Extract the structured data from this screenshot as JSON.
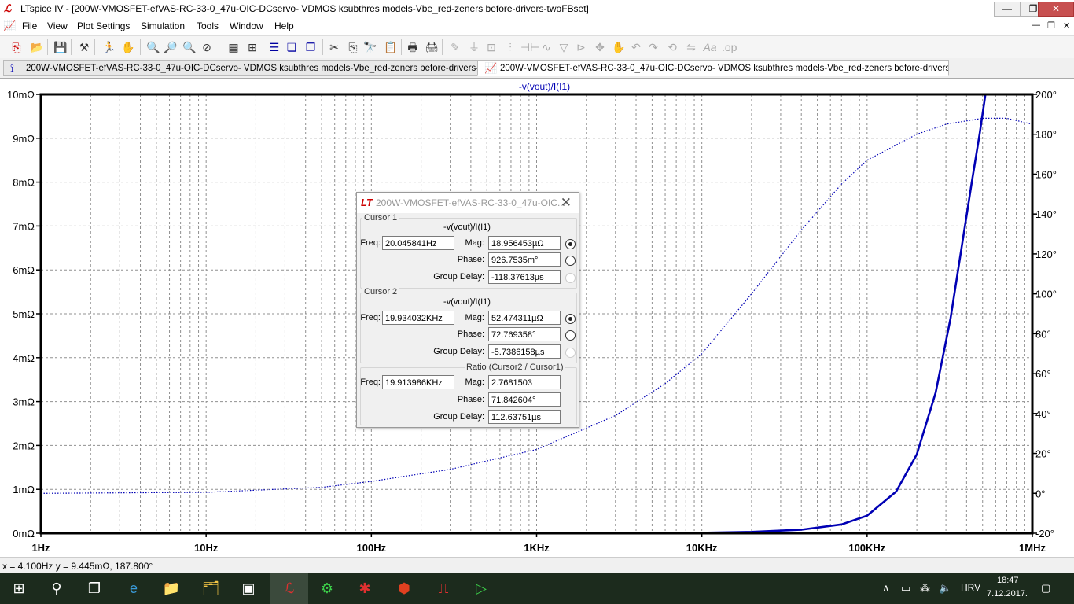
{
  "window": {
    "title": "LTspice IV - [200W-VMOSFET-efVAS-RC-33-0_47u-OIC-DCservo- VDMOS ksubthres models-Vbe_red-zeners before-drivers-twoFBset]",
    "min": "—",
    "max": "❐",
    "close": "✕"
  },
  "menu": [
    "File",
    "View",
    "Plot Settings",
    "Simulation",
    "Tools",
    "Window",
    "Help"
  ],
  "tabs": [
    {
      "label": "200W-VMOSFET-efVAS-RC-33-0_47u-OIC-DCservo- VDMOS ksubthres models-Vbe_red-zeners before-drivers-twoFBset",
      "icon": "schematic-icon"
    },
    {
      "label": "200W-VMOSFET-efVAS-RC-33-0_47u-OIC-DCservo- VDMOS ksubthres models-Vbe_red-zeners before-drivers-twoFBset",
      "icon": "waveform-icon"
    }
  ],
  "chart_data": {
    "type": "line",
    "title": "-v(vout)/I(I1)",
    "x_scale": "log",
    "xlim": [
      1,
      1000000
    ],
    "x_ticks": [
      "1Hz",
      "10Hz",
      "100Hz",
      "1KHz",
      "10KHz",
      "100KHz",
      "1MHz"
    ],
    "y_left_ticks": [
      "0mΩ",
      "1mΩ",
      "2mΩ",
      "3mΩ",
      "4mΩ",
      "5mΩ",
      "6mΩ",
      "7mΩ",
      "8mΩ",
      "9mΩ",
      "10mΩ"
    ],
    "y_left_lim_mohm": [
      0,
      10
    ],
    "y_right_ticks": [
      "-20°",
      "0°",
      "20°",
      "40°",
      "60°",
      "80°",
      "100°",
      "120°",
      "140°",
      "160°",
      "180°",
      "200°"
    ],
    "y_right_lim_deg": [
      -20,
      200
    ],
    "grid": true,
    "series": [
      {
        "name": "magnitude",
        "style": "solid",
        "color": "#0000b4",
        "axis": "left",
        "x": [
          1,
          100,
          10000,
          20000,
          40000,
          70000,
          100000,
          150000,
          200000,
          260000,
          320000,
          380000,
          430000,
          480000,
          520000
        ],
        "y": [
          0.0,
          0.0,
          0.01,
          0.03,
          0.08,
          0.2,
          0.4,
          0.95,
          1.8,
          3.2,
          4.9,
          6.7,
          8.0,
          9.1,
          10.0
        ]
      },
      {
        "name": "phase",
        "style": "dotted",
        "color": "#0000b4",
        "axis": "right",
        "x": [
          1,
          10,
          50,
          100,
          300,
          1000,
          3000,
          6000,
          10000,
          20000,
          40000,
          70000,
          100000,
          200000,
          300000,
          500000,
          700000,
          1000000
        ],
        "y": [
          0,
          0.5,
          3,
          6,
          12,
          22,
          39,
          55,
          70,
          100,
          132,
          155,
          167,
          180,
          185,
          188,
          188,
          185
        ]
      }
    ]
  },
  "dialog": {
    "title": "200W-VMOSFET-efVAS-RC-33-0_47u-OIC...",
    "close": "✕",
    "cursor1": {
      "group_label": "Cursor 1",
      "expr": "-v(vout)/I(I1)",
      "freq_label": "Freq:",
      "freq": "20.045841Hz",
      "mag_label": "Mag:",
      "mag": "18.956453µΩ",
      "phase_label": "Phase:",
      "phase": "926.7535m°",
      "gd_label": "Group Delay:",
      "gd": "-118.37613µs"
    },
    "cursor2": {
      "group_label": "Cursor 2",
      "expr": "-v(vout)/I(I1)",
      "freq_label": "Freq:",
      "freq": "19.934032KHz",
      "mag_label": "Mag:",
      "mag": "52.474311µΩ",
      "phase_label": "Phase:",
      "phase": "72.769358°",
      "gd_label": "Group Delay:",
      "gd": "-5.7386158µs"
    },
    "ratio": {
      "group_label": "Ratio (Cursor2 / Cursor1)",
      "freq_label": "Freq:",
      "freq": "19.913986KHz",
      "mag_label": "Mag:",
      "mag": "2.7681503",
      "phase_label": "Phase:",
      "phase": "71.842604°",
      "gd_label": "Group Delay:",
      "gd": "112.63751µs"
    }
  },
  "status": "x = 4.100Hz   y = 9.445mΩ, 187.800°",
  "taskbar": {
    "lang": "HRV",
    "time": "18:47",
    "date": "7.12.2017."
  }
}
